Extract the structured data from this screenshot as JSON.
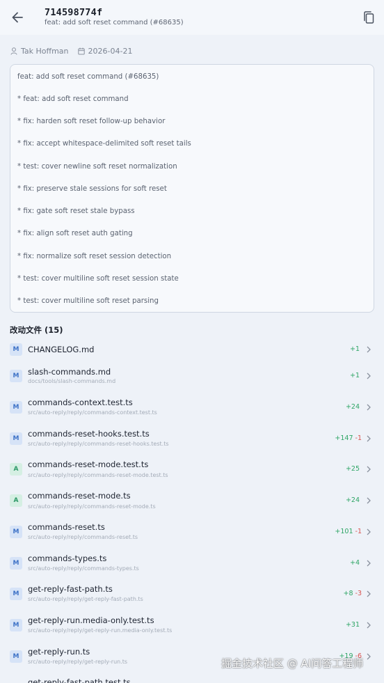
{
  "header": {
    "sha": "714598774f",
    "subtitle": "feat: add soft reset command (#68635)"
  },
  "meta": {
    "author": "Tak Hoffman",
    "date": "2026-04-21"
  },
  "message_lines": [
    "feat: add soft reset command (#68635)",
    "* feat: add soft reset command",
    "* fix: harden soft reset follow-up behavior",
    "* fix: accept whitespace-delimited soft reset tails",
    "* test: cover newline soft reset normalization",
    "* fix: preserve stale sessions for soft reset",
    "* fix: gate soft reset stale bypass",
    "* fix: align soft reset auth gating",
    "* fix: normalize soft reset session detection",
    "* test: cover multiline soft reset session state",
    "* test: cover multiline soft reset parsing"
  ],
  "files_section": {
    "title": "改动文件",
    "count": "(15)"
  },
  "files": [
    {
      "status": "M",
      "name": "CHANGELOG.md",
      "path": "",
      "add": "+1",
      "del": ""
    },
    {
      "status": "M",
      "name": "slash-commands.md",
      "path": "docs/tools/slash-commands.md",
      "add": "+1",
      "del": ""
    },
    {
      "status": "M",
      "name": "commands-context.test.ts",
      "path": "src/auto-reply/reply/commands-context.test.ts",
      "add": "+24",
      "del": ""
    },
    {
      "status": "M",
      "name": "commands-reset-hooks.test.ts",
      "path": "src/auto-reply/reply/commands-reset-hooks.test.ts",
      "add": "+147",
      "del": "-1"
    },
    {
      "status": "A",
      "name": "commands-reset-mode.test.ts",
      "path": "src/auto-reply/reply/commands-reset-mode.test.ts",
      "add": "+25",
      "del": ""
    },
    {
      "status": "A",
      "name": "commands-reset-mode.ts",
      "path": "src/auto-reply/reply/commands-reset-mode.ts",
      "add": "+24",
      "del": ""
    },
    {
      "status": "M",
      "name": "commands-reset.ts",
      "path": "src/auto-reply/reply/commands-reset.ts",
      "add": "+101",
      "del": "-1"
    },
    {
      "status": "M",
      "name": "commands-types.ts",
      "path": "src/auto-reply/reply/commands-types.ts",
      "add": "+4",
      "del": ""
    },
    {
      "status": "M",
      "name": "get-reply-fast-path.ts",
      "path": "src/auto-reply/reply/get-reply-fast-path.ts",
      "add": "+8",
      "del": "-3"
    },
    {
      "status": "M",
      "name": "get-reply-run.media-only.test.ts",
      "path": "src/auto-reply/reply/get-reply-run.media-only.test.ts",
      "add": "+31",
      "del": ""
    },
    {
      "status": "M",
      "name": "get-reply-run.ts",
      "path": "src/auto-reply/reply/get-reply-run.ts",
      "add": "+19",
      "del": "-6"
    },
    {
      "status": "M",
      "name": "get-reply-fast-path.test.ts",
      "path": "",
      "add": "",
      "del": ""
    }
  ],
  "watermark": "掘金技术社区 @ AI问答工程师",
  "colors": {
    "background": "#eef2f8",
    "additions": "#2ea565",
    "deletions": "#d9534f",
    "modified_badge": "#3f73c7",
    "added_badge": "#2f9a69"
  },
  "icons": {
    "back": "arrow-left-icon",
    "copy": "copy-icon",
    "author": "person-icon",
    "date": "calendar-icon",
    "row": "chevron-right-icon"
  }
}
